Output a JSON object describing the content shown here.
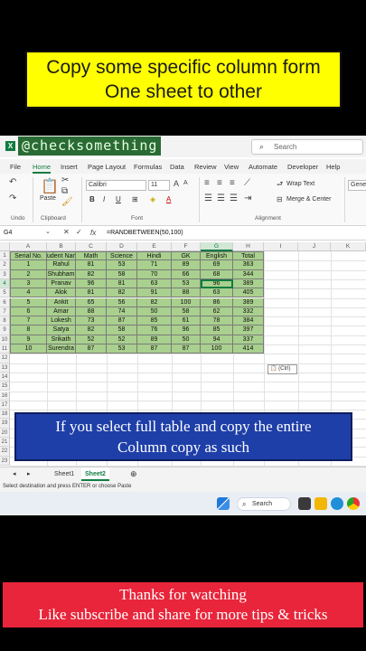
{
  "banner_top": {
    "line1": "Copy some specific column form",
    "line2": "One sheet to other"
  },
  "titlebar": {
    "handle": "@checksomething",
    "search_placeholder": "Search"
  },
  "menu": [
    "File",
    "Home",
    "Insert",
    "Page Layout",
    "Formulas",
    "Data",
    "Review",
    "View",
    "Automate",
    "Developer",
    "Help"
  ],
  "ribbon": {
    "undo_label": "Undo",
    "clipboard_label": "Clipboard",
    "paste_label": "Paste",
    "font_name": "Calibri",
    "font_size": "11",
    "font_label": "Font",
    "wrap_text": "Wrap Text",
    "merge_center": "Merge & Center",
    "alignment_label": "Alignment",
    "number_format": "Gene"
  },
  "formula_bar": {
    "name_box": "G4",
    "fx": "fx",
    "formula": "=RANDBETWEEN(50,100)"
  },
  "columns": [
    "A",
    "B",
    "C",
    "D",
    "E",
    "F",
    "G",
    "H",
    "I",
    "J",
    "K"
  ],
  "rows": [
    "1",
    "2",
    "3",
    "4",
    "5",
    "6",
    "7",
    "8",
    "9",
    "10",
    "11",
    "12",
    "13",
    "14",
    "15",
    "16",
    "17",
    "18",
    "19",
    "20",
    "21",
    "22",
    "23"
  ],
  "table": {
    "headers": [
      "Serial No.",
      "Student Name",
      "Math",
      "Science",
      "Hindi",
      "GK",
      "English",
      "Total"
    ],
    "header_display": [
      "Serial No.",
      "udent Nam",
      "Math",
      "Science",
      "Hindi",
      "GK",
      "English",
      "Total"
    ],
    "data": [
      [
        "1",
        "Rahul",
        "81",
        "53",
        "71",
        "89",
        "69",
        "363"
      ],
      [
        "2",
        "Shubham",
        "82",
        "58",
        "70",
        "66",
        "68",
        "344"
      ],
      [
        "3",
        "Pranav",
        "96",
        "81",
        "63",
        "53",
        "96",
        "389"
      ],
      [
        "4",
        "Alok",
        "81",
        "82",
        "91",
        "88",
        "63",
        "405"
      ],
      [
        "5",
        "Ankit",
        "65",
        "56",
        "82",
        "100",
        "86",
        "389"
      ],
      [
        "6",
        "Amar",
        "88",
        "74",
        "50",
        "58",
        "62",
        "332"
      ],
      [
        "7",
        "Lokesh",
        "73",
        "87",
        "85",
        "61",
        "78",
        "384"
      ],
      [
        "8",
        "Satya",
        "82",
        "58",
        "76",
        "96",
        "85",
        "397"
      ],
      [
        "9",
        "Srikath",
        "52",
        "52",
        "89",
        "50",
        "94",
        "337"
      ],
      [
        "10",
        "Surendra",
        "87",
        "53",
        "87",
        "87",
        "100",
        "414"
      ]
    ]
  },
  "paste_options": "(Ctrl)",
  "blue_banner": {
    "line1": "If you select full table and copy the entire",
    "line2": "Column copy as such"
  },
  "sheets": [
    "Sheet1",
    "Sheet2"
  ],
  "active_sheet": "Sheet2",
  "status_text": "Select destination and press ENTER or choose Paste",
  "taskbar": {
    "search": "Search"
  },
  "red_banner": {
    "line1": "Thanks for watching",
    "line2": "Like subscribe and share for more tips & tricks"
  },
  "colors": {
    "excel_green": "#107c41",
    "cell_green": "#a9d08e",
    "banner_yellow": "#ffff00",
    "banner_blue": "#1e3fa8",
    "banner_red": "#e8253a"
  }
}
